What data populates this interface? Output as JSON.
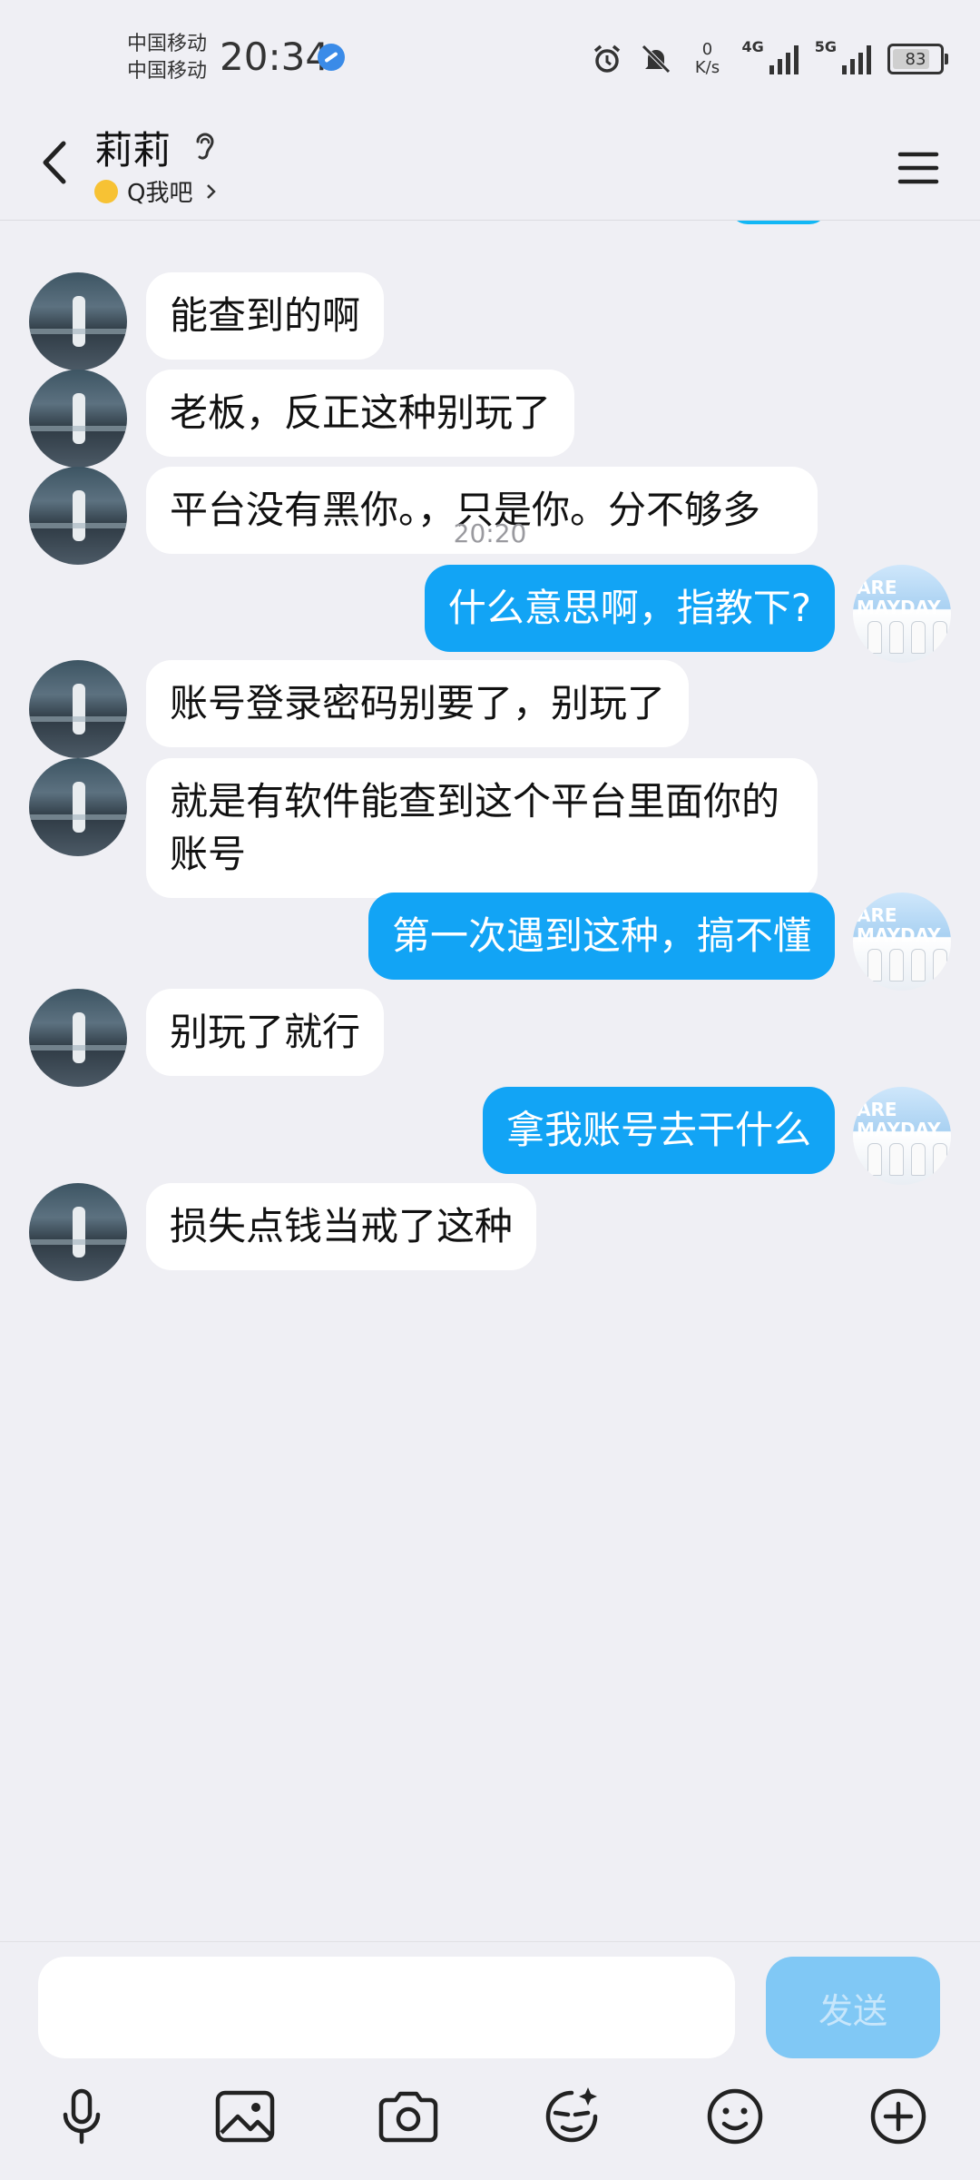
{
  "status_bar": {
    "carrier_1": "中国移动",
    "carrier_2": "中国移动",
    "time": "20:34",
    "speed_value": "0",
    "speed_unit": "K/s",
    "net_1": "4G",
    "net_2": "5G",
    "battery": "83"
  },
  "header": {
    "contact_name": "莉莉",
    "subtitle": "Q我吧"
  },
  "messages": [
    {
      "dir": "in",
      "text": "能查到的啊"
    },
    {
      "dir": "in",
      "text": "老板，反正这种别玩了"
    },
    {
      "dir": "in",
      "text": "平台没有黑你。，只是你。分不够多"
    },
    {
      "type": "time",
      "text": "20:20"
    },
    {
      "dir": "out",
      "text": "什么意思啊，指教下?"
    },
    {
      "dir": "in",
      "text": "账号登录密码别要了，别玩了"
    },
    {
      "dir": "in",
      "text": "就是有软件能查到这个平台里面你的账号"
    },
    {
      "dir": "out",
      "text": "第一次遇到这种，搞不懂"
    },
    {
      "dir": "in",
      "text": "别玩了就行"
    },
    {
      "dir": "out",
      "text": "拿我账号去干什么"
    },
    {
      "dir": "in",
      "text": "损失点钱当戒了这种"
    }
  ],
  "out_avatar_text": "ARE MAYDAY",
  "composer": {
    "input_value": "",
    "send_label": "发送"
  },
  "toolbar_icons": [
    "microphone-icon",
    "image-icon",
    "camera-icon",
    "sticker-icon",
    "emoji-icon",
    "plus-icon"
  ],
  "colors": {
    "outgoing_bubble": "#12a4f5",
    "incoming_bubble": "#ffffff",
    "send_button": "#80c8f5",
    "background": "#efeff4"
  }
}
